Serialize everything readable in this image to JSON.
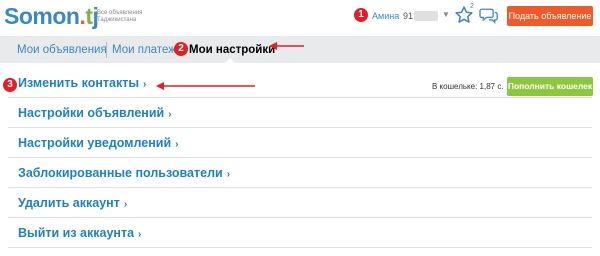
{
  "header": {
    "logo": {
      "part1": "Somon",
      "part2": ".",
      "part3": "t",
      "part4": "j"
    },
    "tagline": "Все объявления Таджикистана",
    "user_name": "Амина",
    "user_phone_prefix": "91",
    "favorites_count": "2",
    "post_ad_label": "Подать объявление"
  },
  "nav": {
    "tabs": [
      {
        "label": "Мои объявления"
      },
      {
        "label": "Мои платежи"
      },
      {
        "label": "Мои настройки"
      }
    ],
    "wallet_text": "В кошельке: 1,87 с.",
    "topup_label": "Пополнить кошелек"
  },
  "annotations": {
    "step1": "1",
    "step2": "2",
    "step3": "3"
  },
  "settings": {
    "items": [
      {
        "label": "Изменить контакты"
      },
      {
        "label": "Настройки объявлений"
      },
      {
        "label": "Настройки уведомлений"
      },
      {
        "label": "Заблокированные пользователи"
      },
      {
        "label": "Удалить аккаунт"
      },
      {
        "label": "Выйти из аккаунта"
      }
    ]
  },
  "colors": {
    "brand_blue": "#3b88c3",
    "brand_orange": "#f05a28",
    "brand_green": "#8dc63f",
    "annotation_red": "#e31e24"
  }
}
